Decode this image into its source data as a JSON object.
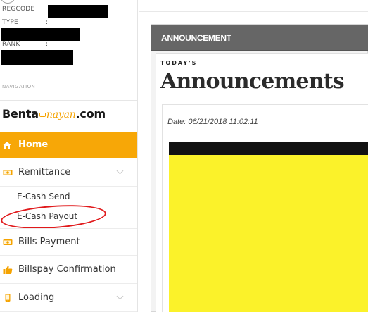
{
  "account": {
    "regcode_label": "REGCODE",
    "type_label": "TYPE",
    "type_colon": ":",
    "rank_label": "RANK",
    "rank_colon": ":"
  },
  "navigation_heading": "NAVIGATION",
  "brand": {
    "part1": "Benta",
    "part2": "nayan",
    "part3": ".com",
    "accent_color": "#f5a300"
  },
  "nav": {
    "home": "Home",
    "remittance": "Remittance",
    "ecash_send": "E-Cash Send",
    "ecash_payout": "E-Cash Payout",
    "bills_payment": "Bills Payment",
    "billspay_confirmation": "Billspay Confirmation",
    "loading": "Loading"
  },
  "colors": {
    "active_nav": "#f7a707",
    "highlight_circle": "#e0191b",
    "panel_header": "#666666",
    "banner_yellow": "#fbf22a"
  },
  "announcement": {
    "panel_title": "ANNOUNCEMENT",
    "kicker": "TODAY'S",
    "heading": "Announcements",
    "date": "Date:  06/21/2018 11:02:11"
  },
  "icons": {
    "home": "home-icon",
    "remittance": "money-icon",
    "bills_payment": "money-icon",
    "billspay_confirmation": "thumbs-up-icon",
    "loading": "mobile-phone-icon"
  }
}
